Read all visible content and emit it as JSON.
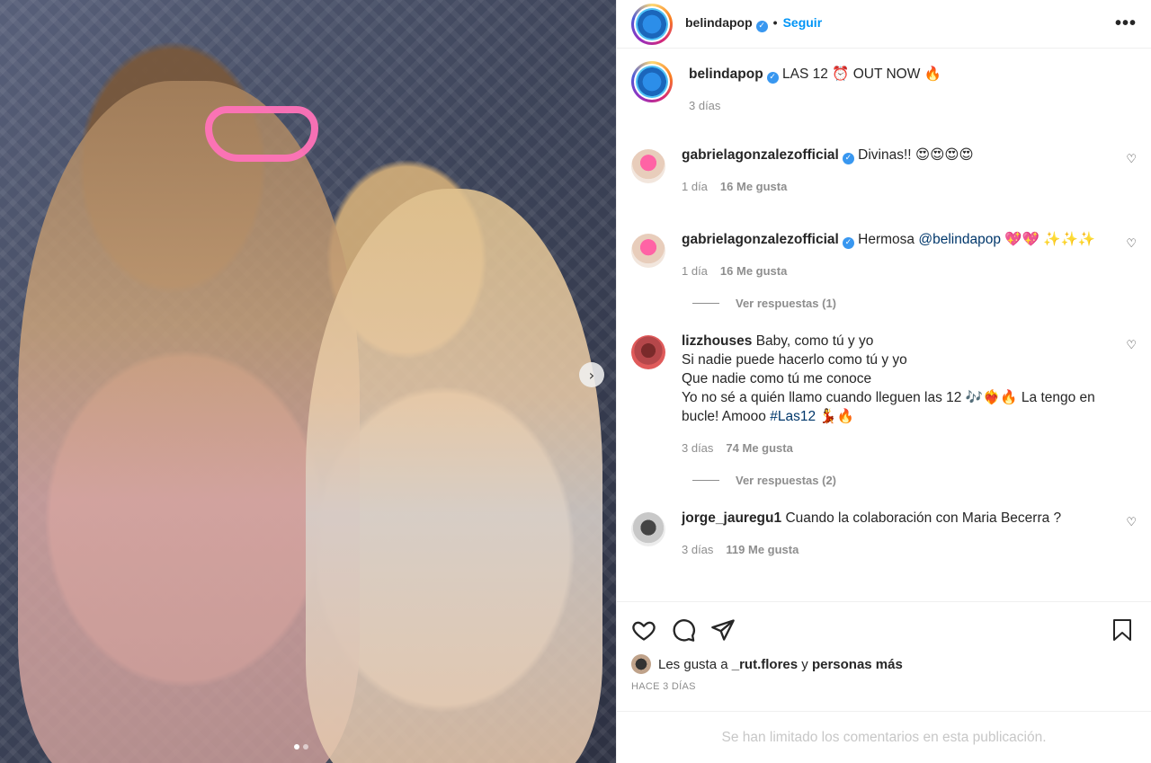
{
  "post": {
    "author": "belindapop",
    "follow_label": "Seguir",
    "more_label": "•••"
  },
  "caption": {
    "username": "belindapop",
    "text": "LAS 12 ⏰ OUT NOW 🔥",
    "time": "3 días"
  },
  "comments": [
    {
      "username": "gabrielagonzalezofficial",
      "verified": true,
      "text": "Divinas!! 😍😍😍😍",
      "time": "1 día",
      "likes": "16 Me gusta"
    },
    {
      "username": "gabrielagonzalezofficial",
      "verified": true,
      "text_pre": "Hermosa ",
      "mention": "@belindapop",
      "text_post": " 💖💖 ✨✨✨",
      "time": "1 día",
      "likes": "16 Me gusta",
      "replies": "Ver respuestas (1)"
    },
    {
      "username": "lizzhouses",
      "verified": false,
      "lines": [
        "Baby, como tú y yo",
        "Si nadie puede hacerlo como tú y yo",
        "Que nadie como tú me conoce",
        "Yo no sé a quién llamo cuando lleguen las 12 🎶❤️‍🔥🔥 La tengo en bucle! Amooo "
      ],
      "hashtag": "#Las12",
      "tail": " 💃🔥",
      "time": "3 días",
      "likes": "74 Me gusta",
      "replies": "Ver respuestas (2)"
    },
    {
      "username": "jorge_jauregu1",
      "verified": false,
      "text": "Cuando la colaboración con Maria Becerra ?",
      "time": "3 días",
      "likes": "119 Me gusta"
    }
  ],
  "likes": {
    "prefix": "Les gusta a ",
    "user": "_rut.flores",
    "middle": " y ",
    "suffix": "personas más"
  },
  "time_ago": "HACE 3 DÍAS",
  "comments_limited": "Se han limitado los comentarios en esta publicación.",
  "carousel": {
    "next_icon": "chevron-right-icon",
    "current_slide": 1,
    "slide_count": 2
  },
  "icons": {
    "heart": "heart-icon",
    "comment": "comment-icon",
    "share": "share-icon",
    "bookmark": "bookmark-icon"
  }
}
